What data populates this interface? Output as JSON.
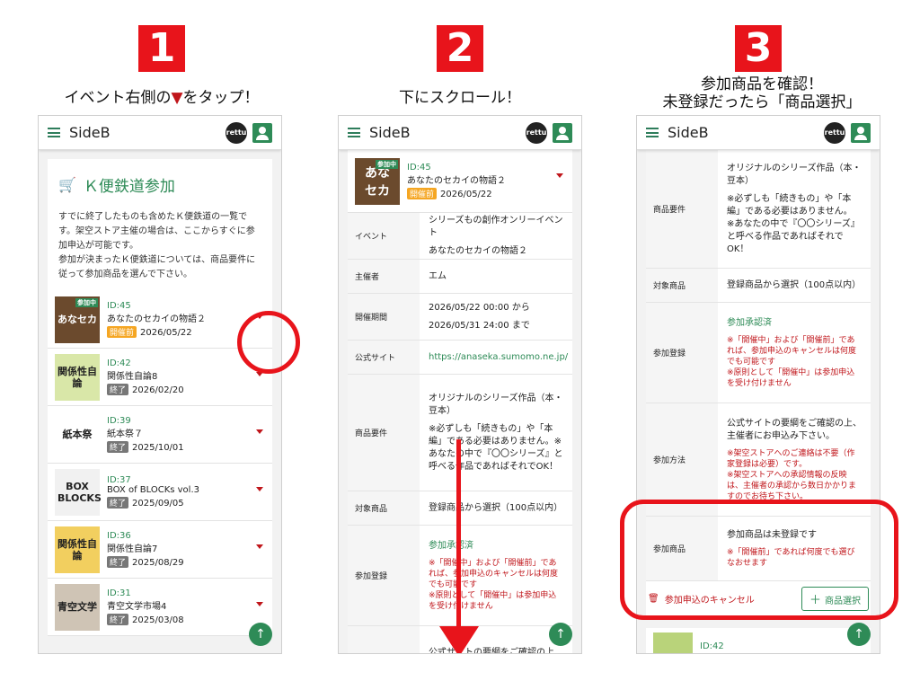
{
  "steps": [
    {
      "num": "1",
      "caption_pre": "イベント右側の",
      "caption_tri": "▼",
      "caption_post": "をタップ！"
    },
    {
      "num": "2",
      "caption": "下にスクロール！"
    },
    {
      "num": "3",
      "caption_l1": "参加商品を確認！",
      "caption_l2": "未登録だったら「商品選択」"
    }
  ],
  "app": {
    "brand": "SideB",
    "logo": "rettu"
  },
  "screen1": {
    "title": "Ｋ便鉄道参加",
    "desc": "すでに終了したものも含めたＫ便鉄道の一覧です。架空ストア主催の場合は、ここからすぐに参加申込が可能です。\n参加が決まったＫ便鉄道については、商品要件に従って参加商品を選んで下さい。",
    "events": [
      {
        "id": "ID:45",
        "name": "あなたのセカイの物語２",
        "status": "開催前",
        "date": "2026/05/22",
        "thumb": "あなセカ",
        "thumb_badge": "参加中",
        "open": true
      },
      {
        "id": "ID:42",
        "name": "関係性自論8",
        "status": "終了",
        "date": "2026/02/20",
        "thumb": "関係性自論",
        "open": false
      },
      {
        "id": "ID:39",
        "name": "紙本祭７",
        "status": "終了",
        "date": "2025/10/01",
        "thumb": "紙本祭",
        "open": false
      },
      {
        "id": "ID:37",
        "name": "BOX of BLOCKs vol.3",
        "status": "終了",
        "date": "2025/09/05",
        "thumb": "BOX BLOCKS",
        "open": false
      },
      {
        "id": "ID:36",
        "name": "関係性自論7",
        "status": "終了",
        "date": "2025/08/29",
        "thumb": "関係性自論",
        "open": false
      },
      {
        "id": "ID:31",
        "name": "青空文学市場4",
        "status": "終了",
        "date": "2025/03/08",
        "thumb": "青空文学",
        "open": false
      }
    ]
  },
  "screen2": {
    "event": {
      "id": "ID:45",
      "name": "あなたのセカイの物語２",
      "status": "開催前",
      "date": "2026/05/22",
      "thumb": "あなセカ",
      "thumb_badge": "参加中"
    },
    "rows": [
      {
        "label": "イベント",
        "l1": "シリーズもの創作オンリーイベント",
        "l2": "あなたのセカイの物語２"
      },
      {
        "label": "主催者",
        "l1": "エム"
      },
      {
        "label": "開催期間",
        "l1": "2026/05/22 00:00 から",
        "l2": "2026/05/31 24:00 まで"
      },
      {
        "label": "公式サイト",
        "l1": "https://anaseka.sumomo.ne.jp/"
      },
      {
        "label": "商品要件",
        "l1": "オリジナルのシリーズ作品（本・豆本）",
        "l2": "※必ずしも「続きもの」や「本編」である必要はありません。※あなたの中で『〇〇シリーズ』と呼べる作品であればそれでOK！"
      },
      {
        "label": "対象商品",
        "l1": "登録商品から選択（100点以内）"
      },
      {
        "label": "参加登録",
        "l1": "参加承認済",
        "l2": "※「開催中」および「開催前」であれば、参加申込のキャンセルは何度でも可能です\n※原則として「開催中」は参加申込を受け付けません"
      },
      {
        "label": "",
        "l1": "公式サイトの要綱をご確認の上"
      }
    ]
  },
  "screen3": {
    "rows": [
      {
        "label": "商品要件",
        "l1": "オリジナルのシリーズ作品（本・豆本）",
        "l2": "※必ずしも「続きもの」や「本編」である必要はありません。\n※あなたの中で『〇〇シリーズ』と呼べる作品であればそれでOK！"
      },
      {
        "label": "対象商品",
        "l1": "登録商品から選択（100点以内）"
      },
      {
        "label": "参加登録",
        "l1": "参加承認済",
        "l2": "※「開催中」および「開催前」であれば、参加申込のキャンセルは何度でも可能です\n※原則として「開催中」は参加申込を受け付けません"
      },
      {
        "label": "参加方法",
        "l1": "公式サイトの要綱をご確認の上、主催者にお申込み下さい。",
        "l2": "※架空ストアへのご連絡は不要（作家登録は必要）です。\n※架空ストアへの承認情報の反映は、主催者の承認から数日かかりますのでお待ち下さい。"
      },
      {
        "label": "参加商品",
        "l1": "参加商品は未登録です",
        "l2": "※「開催前」であれば何度でも選びなおせます"
      }
    ],
    "cancel_label": "参加申込のキャンセル",
    "select_label": "商品選択",
    "next_id": "ID:42"
  }
}
